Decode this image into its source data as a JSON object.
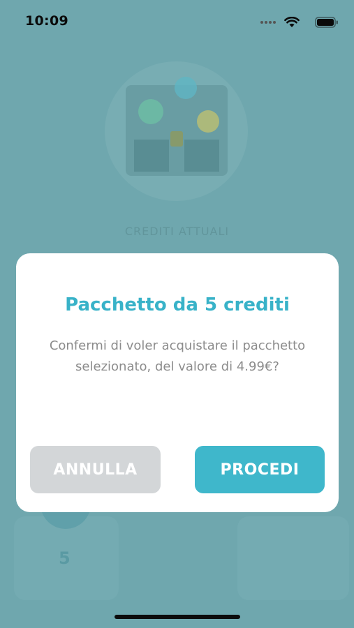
{
  "status_bar": {
    "time": "10:09",
    "icons": [
      "signal-dots-icon",
      "wifi-icon",
      "battery-icon"
    ]
  },
  "background": {
    "credits_label": "CREDITI ATTUALI",
    "package_number": "5"
  },
  "dialog": {
    "title": "Pacchetto da 5 crediti",
    "message": "Confermi di voler acquistare il pacchetto selezionato, del valore di 4.99€?",
    "cancel_label": "ANNULLA",
    "proceed_label": "PROCEDI"
  },
  "colors": {
    "overlay": "#6fa7ae",
    "accent": "#38b2c8",
    "cancel_button": "#d3d6d8",
    "proceed_button": "#3fb7cb"
  }
}
